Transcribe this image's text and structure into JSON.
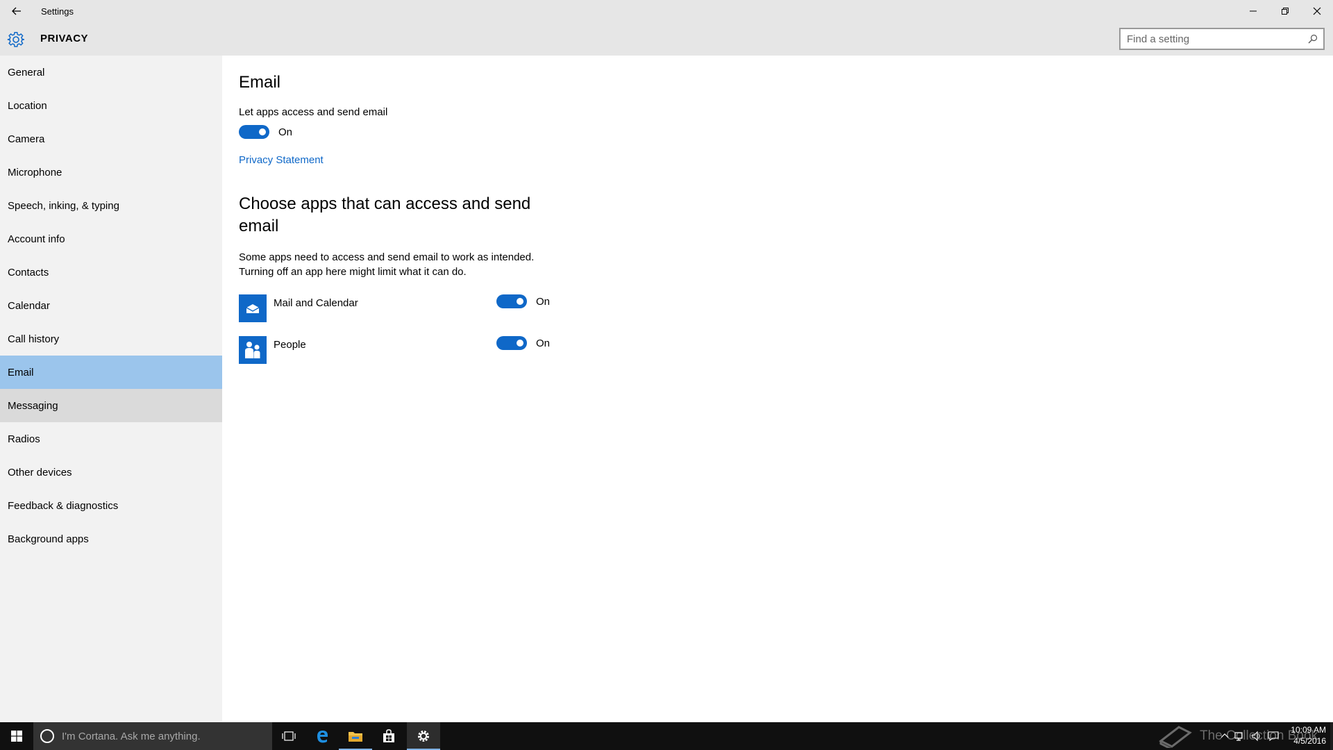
{
  "window": {
    "title": "Settings"
  },
  "header": {
    "section_title": "PRIVACY",
    "search": {
      "placeholder": "Find a setting",
      "value": ""
    }
  },
  "sidebar": {
    "items": [
      {
        "label": "General"
      },
      {
        "label": "Location"
      },
      {
        "label": "Camera"
      },
      {
        "label": "Microphone"
      },
      {
        "label": "Speech, inking, & typing"
      },
      {
        "label": "Account info"
      },
      {
        "label": "Contacts"
      },
      {
        "label": "Calendar"
      },
      {
        "label": "Call history"
      },
      {
        "label": "Email",
        "selected": true
      },
      {
        "label": "Messaging",
        "hovered": true
      },
      {
        "label": "Radios"
      },
      {
        "label": "Other devices"
      },
      {
        "label": "Feedback & diagnostics"
      },
      {
        "label": "Background apps"
      }
    ]
  },
  "main": {
    "title": "Email",
    "setting_label": "Let apps access and send email",
    "master_toggle": {
      "state": "On",
      "on": true
    },
    "privacy_link": "Privacy Statement",
    "subtitle": "Choose apps that can access and send email",
    "description": "Some apps need to access and send email to work as intended. Turning off an app here might limit what it can do.",
    "apps": [
      {
        "name": "Mail and Calendar",
        "icon": "mail-icon",
        "state": "On",
        "on": true
      },
      {
        "name": "People",
        "icon": "people-icon",
        "state": "On",
        "on": true
      }
    ]
  },
  "taskbar": {
    "cortana_placeholder": "I'm Cortana. Ask me anything.",
    "watermark": "The Collection Book",
    "clock": {
      "time": "10:09 AM",
      "date": "4/5/2016"
    }
  },
  "colors": {
    "accent": "#0f68c8",
    "selected_nav": "#9bc5ec",
    "header_bg": "#e6e6e6",
    "sidebar_bg": "#f2f2f2",
    "taskbar_bg": "#101010"
  }
}
